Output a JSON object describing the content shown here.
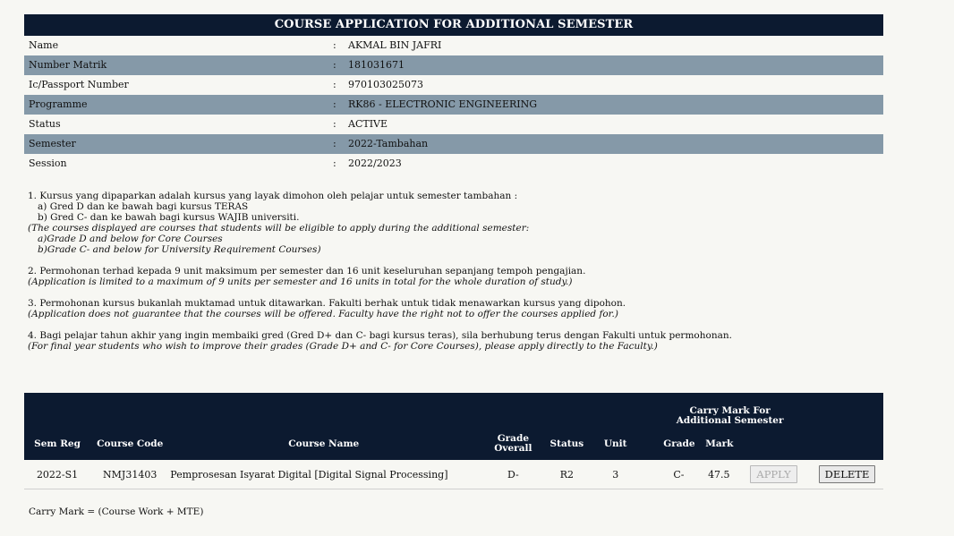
{
  "title": "COURSE APPLICATION FOR ADDITIONAL SEMESTER",
  "colon": ":",
  "info": [
    {
      "label": "Name",
      "value": "AKMAL BIN JAFRI"
    },
    {
      "label": "Number Matrik",
      "value": "181031671"
    },
    {
      "label": "Ic/Passport Number",
      "value": "970103025073"
    },
    {
      "label": "Programme",
      "value": "RK86 - ELECTRONIC ENGINEERING"
    },
    {
      "label": "Status",
      "value": "ACTIVE"
    },
    {
      "label": "Semester",
      "value": "2022-Tambahan"
    },
    {
      "label": "Session",
      "value": "2022/2023"
    }
  ],
  "notes": {
    "n1": "1. Kursus yang dipaparkan adalah kursus yang layak dimohon oleh pelajar untuk semester tambahan :",
    "n1a": "a) Gred D dan ke bawah bagi kursus TERAS",
    "n1b": "b) Gred C- dan ke bawah bagi kursus WAJIB universiti.",
    "n1_en": "(The courses displayed are courses that students will be eligible to apply during the additional semester:",
    "n1a_en": "a)Grade D and below for Core Courses",
    "n1b_en": "b)Grade C- and below for University Requirement Courses)",
    "n2": "2. Permohonan terhad kepada 9 unit maksimum per semester dan 16 unit keseluruhan sepanjang tempoh pengajian.",
    "n2_en": "(Application is limited to a maximum of 9 units per semester and 16 units in total for the whole duration of study.)",
    "n3": "3. Permohonan kursus bukanlah muktamad untuk ditawarkan. Fakulti berhak untuk tidak menawarkan kursus yang dipohon.",
    "n3_en": "(Application does not guarantee that the courses will be offered. Faculty have the right not to offer the courses applied for.)",
    "n4": "4. Bagi pelajar tahun akhir yang ingin membaiki gred (Gred D+ dan C- bagi kursus teras), sila berhubung terus dengan Fakulti untuk permohonan.",
    "n4_en": "(For final year students who wish to improve their grades (Grade D+ and C- for Core Courses), please apply directly to the Faculty.)"
  },
  "table": {
    "group_header": "Carry Mark For Additional Semester",
    "headers": {
      "sem_reg": "Sem Reg",
      "course_code": "Course Code",
      "course_name": "Course Name",
      "grade_overall": "Grade Overall",
      "status": "Status",
      "unit": "Unit",
      "grade": "Grade",
      "mark": "Mark"
    },
    "rows": [
      {
        "sem_reg": "2022-S1",
        "course_code": "NMJ31403",
        "course_name": "Pemprosesan Isyarat Digital [Digital Signal Processing]",
        "grade_overall": "D-",
        "status": "R2",
        "unit": "3",
        "grade": "C-",
        "mark": "47.5",
        "apply_label": "APPLY",
        "delete_label": "DELETE"
      }
    ]
  },
  "footnote": "Carry Mark = (Course Work + MTE)"
}
